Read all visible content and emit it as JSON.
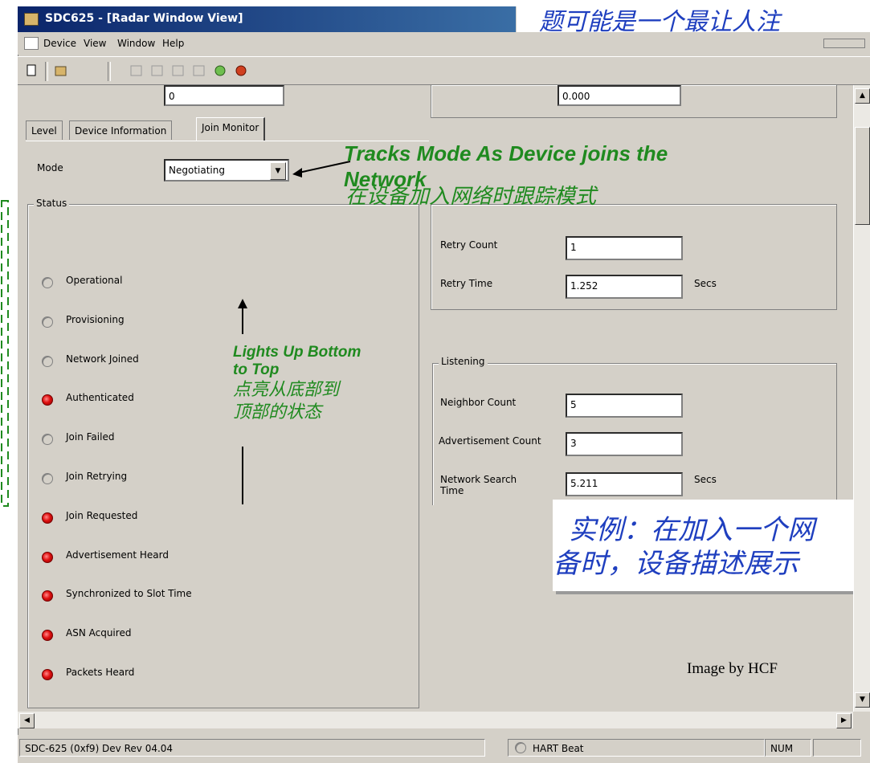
{
  "window": {
    "title": "SDC625 - [Radar Window View]"
  },
  "menu": [
    "Device",
    "View",
    "Window",
    "Help"
  ],
  "top_fields": {
    "left_value": "0",
    "right_value": "0.000"
  },
  "tabs": [
    {
      "label": "Level",
      "active": false
    },
    {
      "label": "Device Information",
      "active": false
    },
    {
      "label": "Join Monitor",
      "active": true
    }
  ],
  "mode": {
    "label": "Mode",
    "value": "Negotiating"
  },
  "status": {
    "title": "Status",
    "items": [
      {
        "label": "Operational",
        "lit": false
      },
      {
        "label": "Provisioning",
        "lit": false
      },
      {
        "label": "Network Joined",
        "lit": false
      },
      {
        "label": "Authenticated",
        "lit": true
      },
      {
        "label": "Join Failed",
        "lit": false
      },
      {
        "label": "Join Retrying",
        "lit": false
      },
      {
        "label": "Join Requested",
        "lit": true
      },
      {
        "label": "Advertisement Heard",
        "lit": true
      },
      {
        "label": "Synchronized to Slot Time",
        "lit": true
      },
      {
        "label": "ASN Acquired",
        "lit": true
      },
      {
        "label": "Packets Heard",
        "lit": true
      }
    ]
  },
  "retry": {
    "count_label": "Retry Count",
    "count_value": "1",
    "time_label": "Retry Time",
    "time_value": "1.252",
    "time_unit": "Secs"
  },
  "listening": {
    "title": "Listening",
    "neighbor_label": "Neighbor Count",
    "neighbor_value": "5",
    "adv_label": "Advertisement Count",
    "adv_value": "3",
    "search_label": "Network Search Time",
    "search_value": "5.211",
    "search_unit": "Secs"
  },
  "annotations": {
    "mode_en": "Tracks Mode As Device joins the Network",
    "mode_cn": "在设备加入网络时跟踪模式",
    "lights_en": "Lights Up Bottom to Top",
    "lights_cn": "点亮从底部到顶部的状态",
    "top_banner_cn": "题可能是一个最让人注",
    "example_cn_1": "实例：在加入一个网",
    "example_cn_2": "备时，设备描述展示",
    "credit": "Image by HCF"
  },
  "statusbar": {
    "device": "SDC-625  (0xf9)  Dev Rev 04.04",
    "beat": "HART Beat",
    "num": "NUM"
  },
  "colors": {
    "lit_led": "#e01010",
    "annotation_green": "#1f8a1f",
    "annotation_blue": "#1f3fbf",
    "titlebar": "#0a246a"
  }
}
